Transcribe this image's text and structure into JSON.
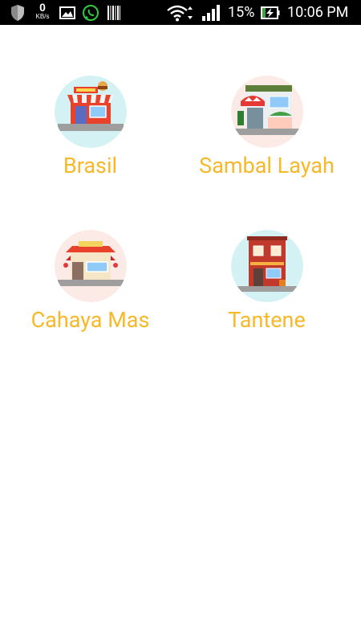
{
  "status_bar": {
    "net_speed_value": "0",
    "net_speed_unit": "KB/s",
    "battery_percent": "15%",
    "time": "10:06 PM",
    "icons": [
      "shield-icon",
      "kbs-indicator",
      "gallery-icon",
      "whatsapp-icon",
      "barcode-icon",
      "wifi-icon",
      "signal-icon",
      "battery-charging-icon"
    ]
  },
  "stores": [
    {
      "name": "Brasil",
      "icon": "red-shop-icon",
      "bg": "#D4F1F4"
    },
    {
      "name": "Sambal Layah",
      "icon": "green-awning-shop-icon",
      "bg": "#FBEAE5"
    },
    {
      "name": "Cahaya Mas",
      "icon": "pagoda-shop-icon",
      "bg": "#FBEAE5"
    },
    {
      "name": "Tantene",
      "icon": "brick-shop-icon",
      "bg": "#D4F1F4"
    }
  ],
  "colors": {
    "accent": "#F7B82A",
    "status_bar": "#000000",
    "background": "#FFFFFF"
  }
}
